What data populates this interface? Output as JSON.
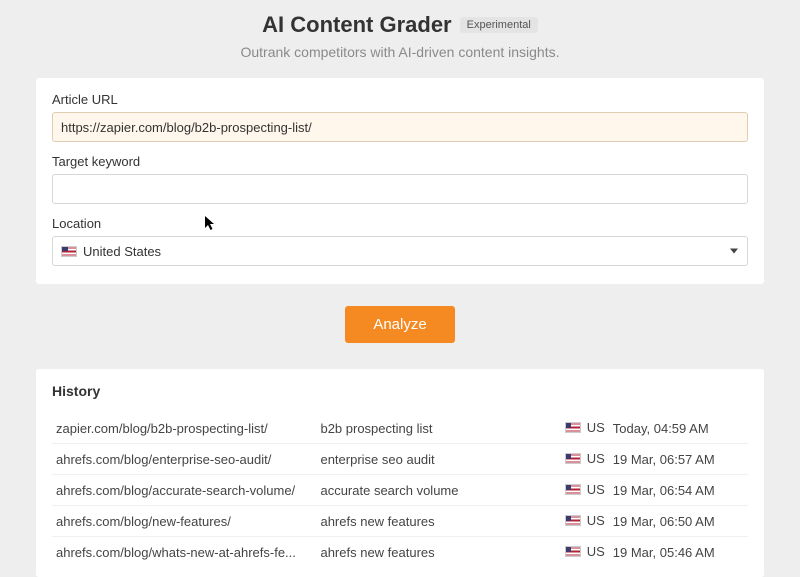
{
  "header": {
    "title": "AI Content Grader",
    "badge": "Experimental",
    "subtitle": "Outrank competitors with AI-driven content insights."
  },
  "form": {
    "url_label": "Article URL",
    "url_value": "https://zapier.com/blog/b2b-prospecting-list/",
    "keyword_label": "Target keyword",
    "keyword_value": "",
    "location_label": "Location",
    "location_value": "United States",
    "analyze_label": "Analyze"
  },
  "history": {
    "title": "History",
    "rows": [
      {
        "url": "zapier.com/blog/b2b-prospecting-list/",
        "kw": "b2b prospecting list",
        "loc": "US",
        "time": "Today, 04:59 AM"
      },
      {
        "url": "ahrefs.com/blog/enterprise-seo-audit/",
        "kw": "enterprise seo audit",
        "loc": "US",
        "time": "19 Mar, 06:57 AM"
      },
      {
        "url": "ahrefs.com/blog/accurate-search-volume/",
        "kw": "accurate search volume",
        "loc": "US",
        "time": "19 Mar, 06:54 AM"
      },
      {
        "url": "ahrefs.com/blog/new-features/",
        "kw": "ahrefs new features",
        "loc": "US",
        "time": "19 Mar, 06:50 AM"
      },
      {
        "url": "ahrefs.com/blog/whats-new-at-ahrefs-fe...",
        "kw": "ahrefs new features",
        "loc": "US",
        "time": "19 Mar, 05:46 AM"
      }
    ]
  }
}
